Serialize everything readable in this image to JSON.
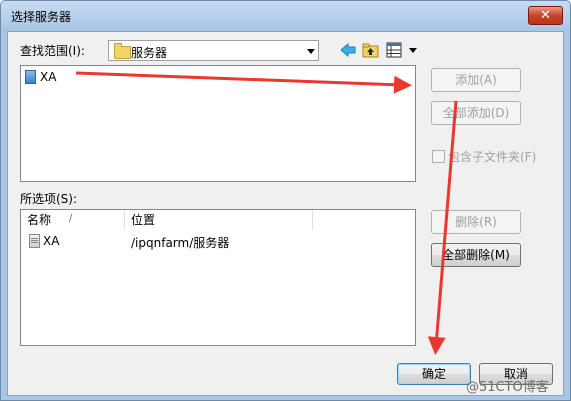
{
  "window": {
    "title": "选择服务器",
    "close_glyph": "✕"
  },
  "look_in": {
    "label": "查找范围(I):",
    "value": "服务器",
    "icons": [
      "folder-icon",
      "back-arrow-icon",
      "up-folder-icon",
      "view-menu-icon"
    ]
  },
  "available": {
    "items": [
      {
        "name": "XA",
        "icon": "server-icon"
      }
    ]
  },
  "buttons": {
    "add": "添加(A)",
    "add_all": "全部添加(D)",
    "remove": "删除(R)",
    "remove_all": "全部删除(M)",
    "ok": "确定",
    "cancel": "取消"
  },
  "include_subfolders": {
    "label": "包含子文件夹(F)",
    "checked": false
  },
  "selected": {
    "label": "所选项(S):",
    "columns": {
      "name": "名称",
      "location": "位置"
    },
    "rows": [
      {
        "name": "XA",
        "location": "/ipqnfarm/服务器"
      }
    ]
  },
  "watermark": "@51CTO博客",
  "colors": {
    "annotation_arrow": "#e8382f",
    "accent_blue": "#3c7fb1"
  }
}
